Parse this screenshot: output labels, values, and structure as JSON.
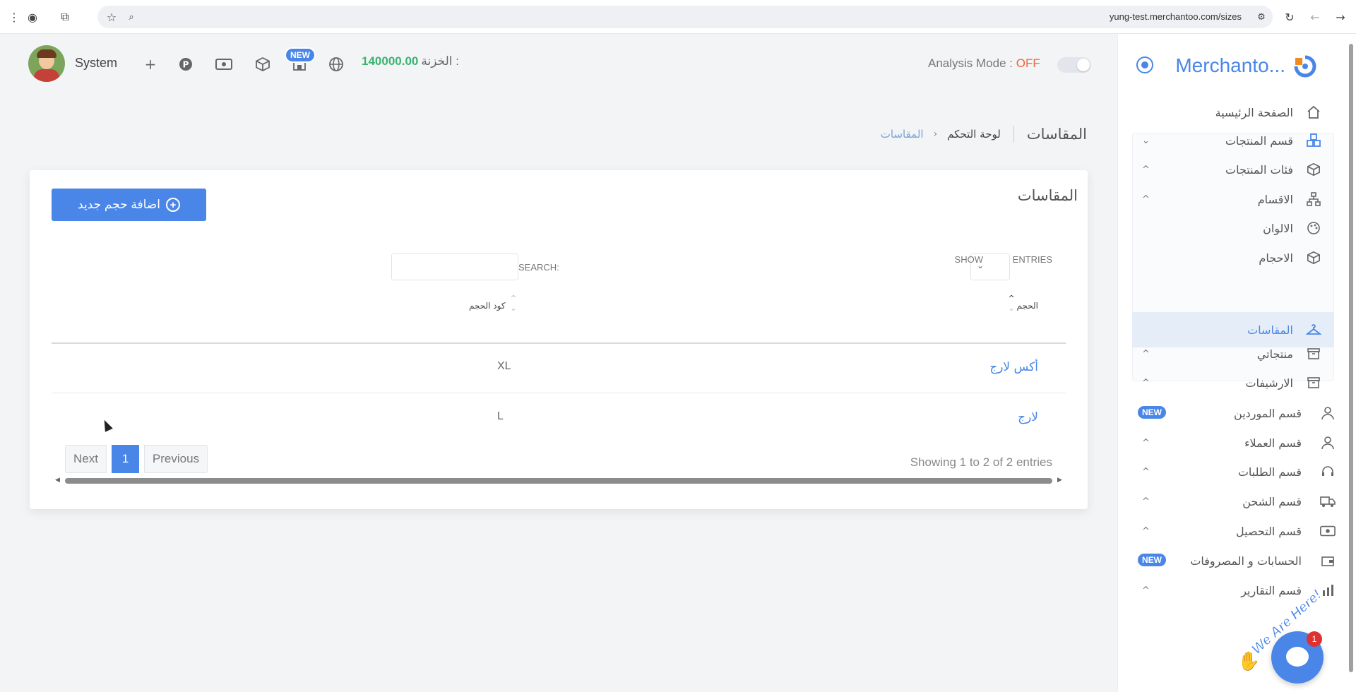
{
  "browser": {
    "url": "yung-test.merchantoo.com/sizes"
  },
  "header": {
    "user_name": "System",
    "new_badge": "NEW",
    "treasury_label": "الخزنة :",
    "treasury_value": "140000.00",
    "analysis_label": "Analysis Mode :",
    "analysis_state": "OFF"
  },
  "breadcrumb": {
    "title": "المقاسات",
    "dashboard": "لوحة التحكم",
    "separator": "‹",
    "current": "المقاسات"
  },
  "card": {
    "title": "المقاسات",
    "add_button": "اضافة حجم جديد",
    "show_label": "SHOW",
    "entries_label": "ENTRIES",
    "search_label": "SEARCH:",
    "search_value": "",
    "columns": [
      "الحجم",
      "كود الحجم"
    ],
    "rows": [
      {
        "name": "أكس لارج",
        "code": "XL"
      },
      {
        "name": "لارج",
        "code": "L"
      }
    ],
    "showing": "Showing 1 to 2 of 2 entries",
    "pagination": {
      "next": "Next",
      "page": "1",
      "previous": "Previous"
    }
  },
  "sidebar": {
    "brand": "Merchanto...",
    "items": [
      {
        "label": "الصفحة الرئيسية",
        "icon": "home-icon"
      },
      {
        "label": "قسم المنتجات",
        "icon": "cubes-icon"
      },
      {
        "label": "فئات المنتجات",
        "icon": "box-icon"
      },
      {
        "label": "الاقسام",
        "icon": "sitemap-icon"
      },
      {
        "label": "الالوان",
        "icon": "palette-icon"
      },
      {
        "label": "الاحجام",
        "icon": "cube-icon"
      },
      {
        "label": "المقاسات",
        "icon": "hanger-icon"
      },
      {
        "label": "منتجاتي",
        "icon": "archive-icon"
      },
      {
        "label": "الارشيفات",
        "icon": "archive-icon"
      },
      {
        "label": "قسم الموردين",
        "icon": "user-icon",
        "badge": "NEW"
      },
      {
        "label": "قسم العملاء",
        "icon": "user-icon"
      },
      {
        "label": "قسم الطلبات",
        "icon": "headset-icon"
      },
      {
        "label": "قسم الشحن",
        "icon": "truck-icon"
      },
      {
        "label": "قسم التحصيل",
        "icon": "money-icon"
      },
      {
        "label": "الحسابات و المصروفات",
        "icon": "wallet-icon",
        "badge": "NEW"
      },
      {
        "label": "قسم التقارير",
        "icon": "chart-icon"
      }
    ]
  },
  "chat": {
    "tagline": "We Are Here!",
    "unread": "1"
  },
  "colors": {
    "accent": "#4a86e8",
    "treasury": "#3cb371",
    "off": "#f0633e"
  }
}
